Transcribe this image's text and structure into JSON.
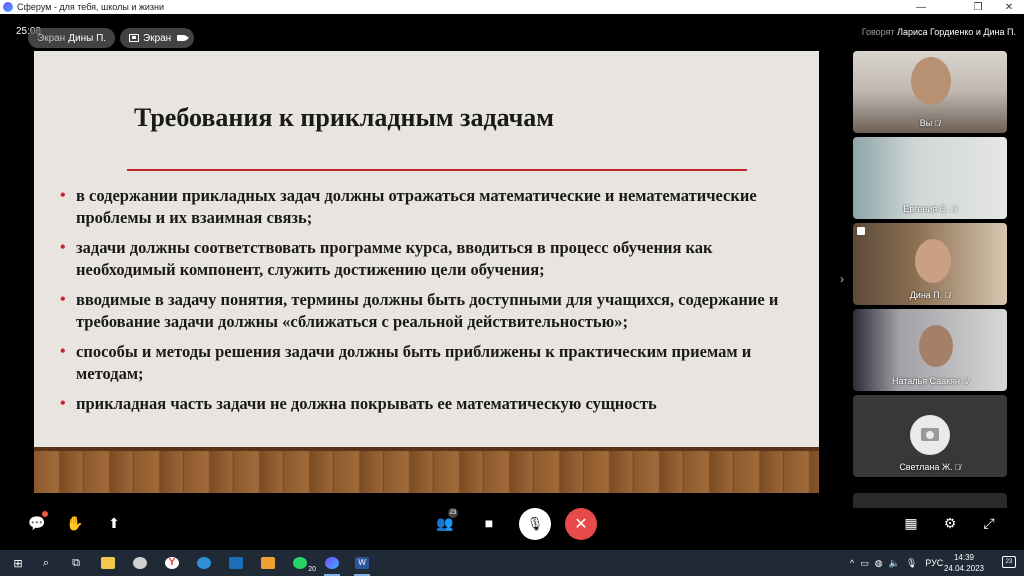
{
  "window": {
    "title": "Сферум - для тебя, школы и жизни",
    "minimize": "—",
    "maximize": "❐",
    "close": "✕"
  },
  "call": {
    "timer": "25:08",
    "speaking_label": "Говорят",
    "speaking_names": "Лариса Гордиенко и Дина П."
  },
  "screen_chip": {
    "prefix": "Экран",
    "owner": "Дины П."
  },
  "screen_mode_chip": {
    "label": "Экран"
  },
  "slide": {
    "title": "Требования к прикладным задачам",
    "bullets": [
      "в содержании прикладных задач должны отражаться математические и нематематические проблемы и их взаимная связь;",
      "задачи должны соответствовать программе курса, вводиться в процесс обучения как необходимый компонент, служить достижению цели обучения;",
      "вводимые в задачу понятия, термины должны быть доступными для учащихся, содержание и требование задачи должны «сближаться с реальной действительностью»;",
      "способы и методы решения задачи должны быть приближены к практическим приемам и методам;",
      "прикладная часть задачи не должна покрывать ее математическую сущность"
    ],
    "colors": {
      "accent": "#c8232c",
      "background": "#e8e5e0"
    }
  },
  "participants": [
    {
      "name": "Вы",
      "muted_icon": "mic-off-icon"
    },
    {
      "name": "Евгения С.",
      "muted_icon": "mic-off-icon"
    },
    {
      "name": "Дина П.",
      "muted_icon": "mic-off-icon"
    },
    {
      "name": "Наталья Саакян",
      "muted_icon": "mic-off-icon"
    },
    {
      "name": "Светлана Ж.",
      "muted_icon": "mic-off-icon"
    }
  ],
  "controls": {
    "participants_count": "23",
    "colors": {
      "end_call": "#e84a4a"
    }
  },
  "taskbar": {
    "whatsapp_badge": "20",
    "language": "РУС",
    "time": "14:39",
    "date": "24.04.2023",
    "notifications": "23"
  }
}
